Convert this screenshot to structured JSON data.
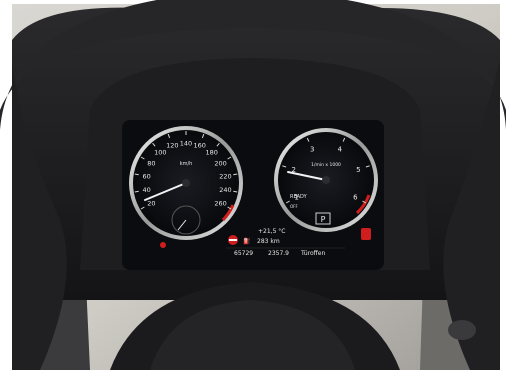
{
  "speedometer": {
    "ticks": [
      "20",
      "40",
      "60",
      "80",
      "100",
      "120",
      "140",
      "160",
      "180",
      "200",
      "220",
      "240",
      "260"
    ],
    "unit": "km/h",
    "needle_value_kmh": 20
  },
  "tachometer": {
    "ticks": [
      "1",
      "2",
      "3",
      "4",
      "5",
      "6"
    ],
    "unit": "1/min x 1000",
    "ready_label": "READY",
    "eco_label": "OFF",
    "needle_value": 1
  },
  "gear_display": "P",
  "info_panel": {
    "outside_temp": "+21,5 °C",
    "range": "283 km",
    "odometer": "65729",
    "trip": "2357.9",
    "door_warning": "Türoffen"
  },
  "colors": {
    "dial_face": "#111318",
    "warning_red": "#d01e1e",
    "needle": "#f2f2f2"
  }
}
